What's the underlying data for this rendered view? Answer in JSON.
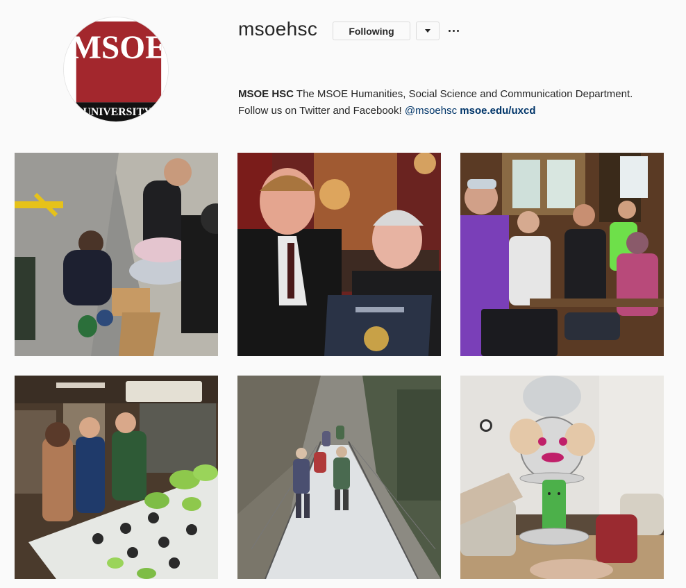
{
  "profile": {
    "username": "msoehsc",
    "following_label": "Following",
    "avatar": {
      "logo_text": "MSOE",
      "sub_text": "UNIVERSITY",
      "brand_color": "#a3272d"
    },
    "bio": {
      "name": "MSOE HSC",
      "text_line1": "The MSOE Humanities, Social Science and Communication Department.",
      "text_line2": "Follow us on Twitter and Facebook!",
      "mention": "@msoehsc",
      "link": "msoe.edu/uxcd"
    }
  },
  "icons": {
    "dropdown": "chevron-down-icon",
    "more": "more-options-icon"
  },
  "posts": [
    {
      "subject": "students painting birdhouses on sidewalk"
    },
    {
      "subject": "two men holding a certificate"
    },
    {
      "subject": "students seated in a group room"
    },
    {
      "subject": "students viewing hydroponic lettuce"
    },
    {
      "subject": "hikers crossing a suspension bridge"
    },
    {
      "subject": "paper plate sculpture"
    }
  ]
}
